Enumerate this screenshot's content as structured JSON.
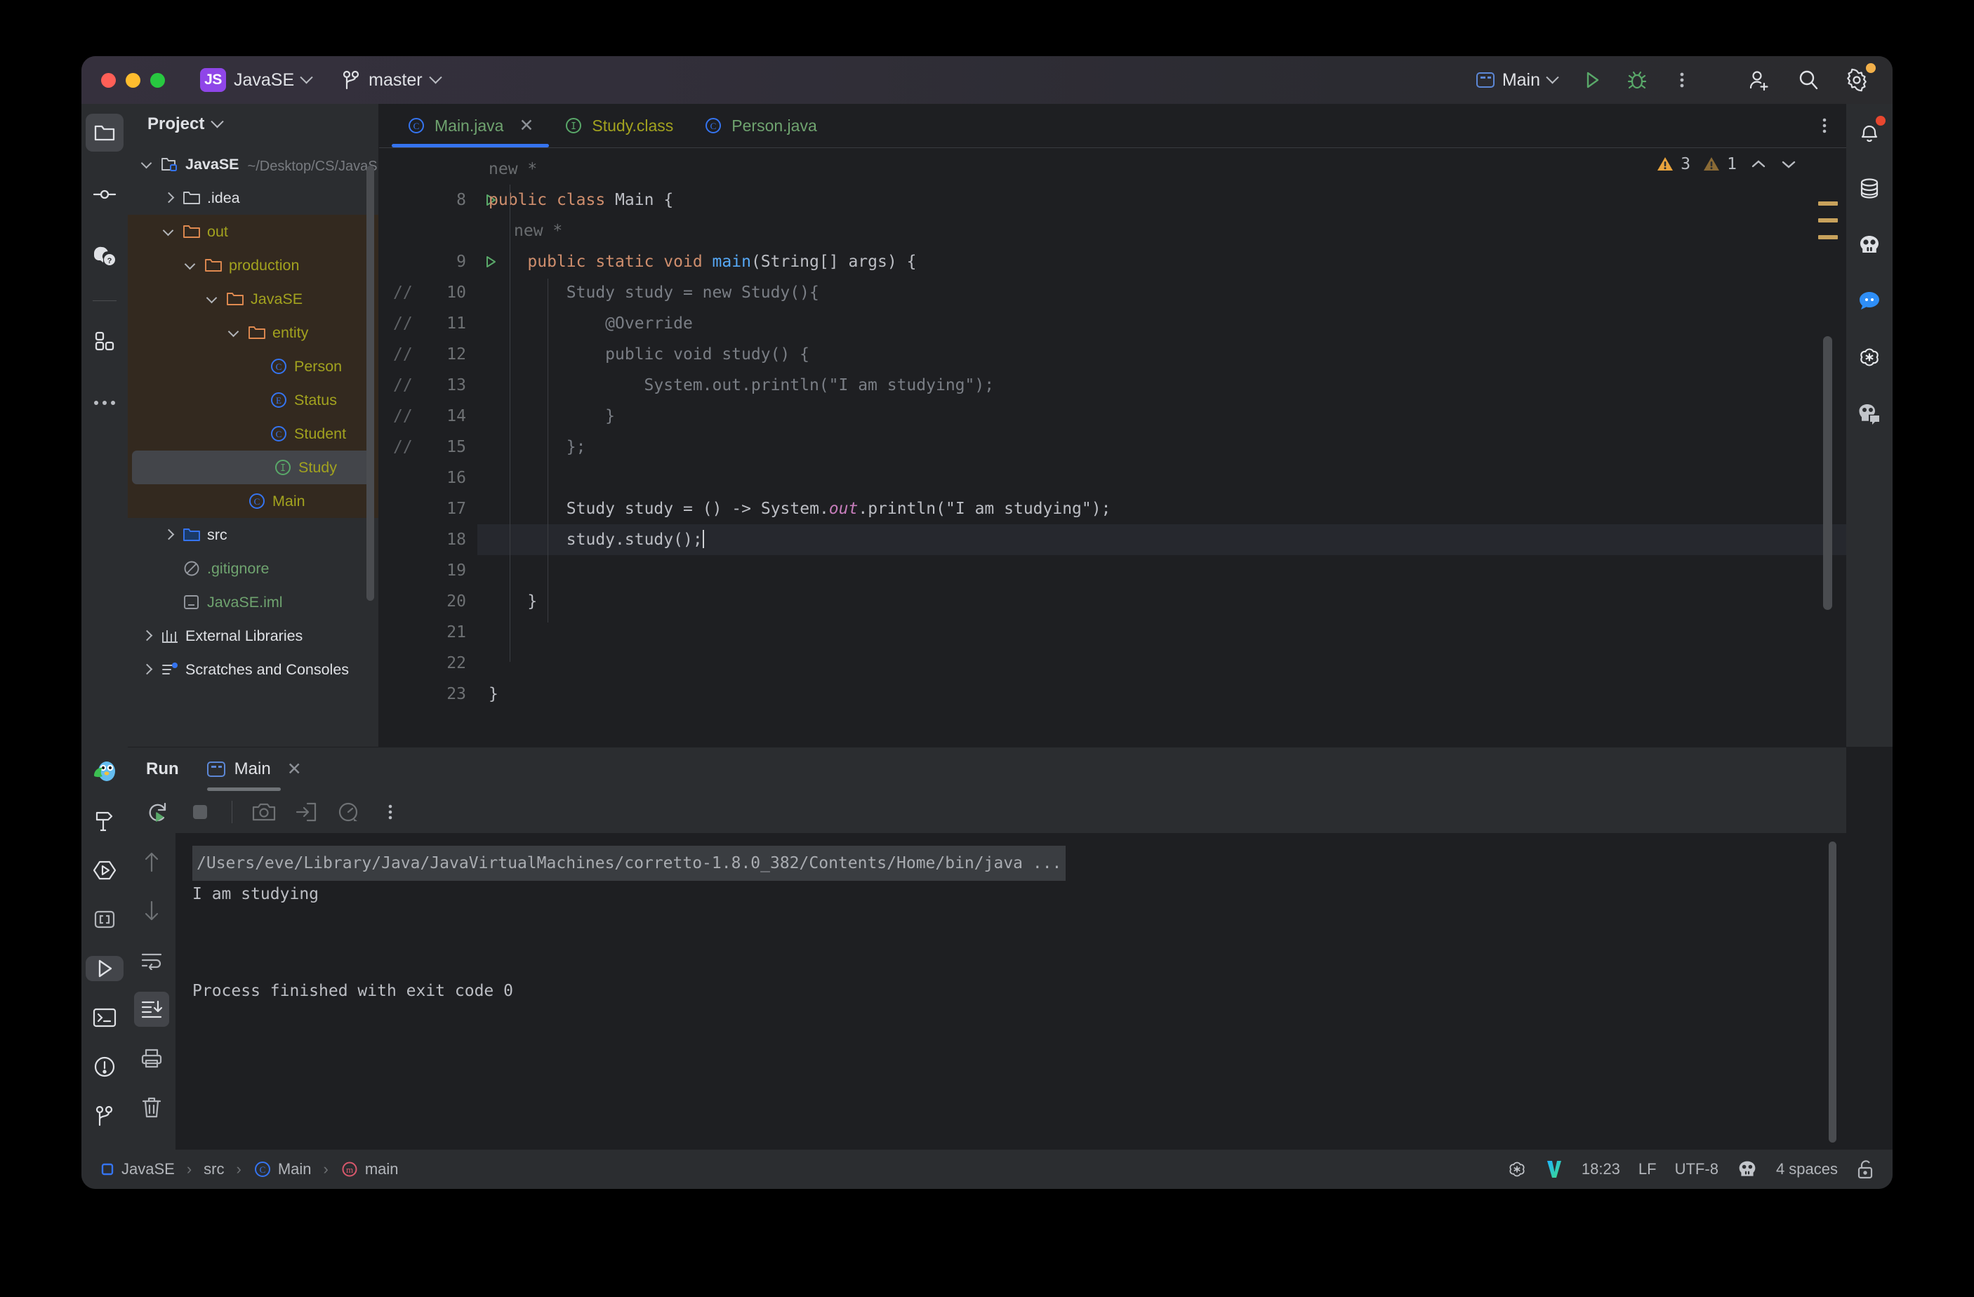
{
  "titlebar": {
    "project_badge": "JS",
    "project_name": "JavaSE",
    "branch": "master",
    "run_config": "Main",
    "icons": {
      "run": "run-icon",
      "debug": "debug-icon",
      "more": "more-vertical-icon",
      "add_user": "add-user-icon",
      "search": "search-icon",
      "settings": "settings-gear-icon"
    }
  },
  "left_rail": {
    "items": [
      {
        "name": "project-tool-window",
        "icon": "folder-icon",
        "active": true
      },
      {
        "name": "commit-tool-window",
        "icon": "commit-icon",
        "active": false
      },
      {
        "name": "ai-assistant-tool-window",
        "icon": "ai-assistant-icon",
        "active": false
      },
      {
        "name": "plugins-tool-window",
        "icon": "grid-squares-icon",
        "active": false
      },
      {
        "name": "more-tool-windows",
        "icon": "more-horizontal-icon",
        "active": false
      }
    ],
    "bottom_items": [
      {
        "name": "mascot-tool-window",
        "icon": "mascot-icon",
        "active": false
      },
      {
        "name": "build-tool-window",
        "icon": "hammer-icon",
        "active": false
      },
      {
        "name": "services-tool-window",
        "icon": "hexagon-play-icon",
        "active": false
      },
      {
        "name": "structure-tool-window",
        "icon": "brackets-icon",
        "active": false
      },
      {
        "name": "run-tool-window",
        "icon": "run-icon",
        "active": true
      },
      {
        "name": "terminal-tool-window",
        "icon": "terminal-icon",
        "active": false
      },
      {
        "name": "problems-tool-window",
        "icon": "warning-circle-icon",
        "active": false
      },
      {
        "name": "version-control-tool-window",
        "icon": "branch-icon",
        "active": false
      }
    ]
  },
  "project_panel": {
    "title": "Project",
    "tree": [
      {
        "label": "JavaSE",
        "sub": "~/Desktop/CS/JavaSE基础",
        "icon": "module-folder-icon",
        "depth": 0,
        "arrow": "open",
        "color": "white",
        "bold": true
      },
      {
        "label": ".idea",
        "sub": "",
        "icon": "folder-icon",
        "depth": 1,
        "arrow": "closed",
        "color": "white",
        "bold": false
      },
      {
        "label": "out",
        "sub": "",
        "icon": "folder-orange-icon",
        "depth": 1,
        "arrow": "open",
        "color": "olive",
        "bold": false
      },
      {
        "label": "production",
        "sub": "",
        "icon": "folder-orange-icon",
        "depth": 2,
        "arrow": "open",
        "color": "olive",
        "bold": false
      },
      {
        "label": "JavaSE",
        "sub": "",
        "icon": "folder-orange-icon",
        "depth": 3,
        "arrow": "open",
        "color": "olive",
        "bold": false
      },
      {
        "label": "entity",
        "sub": "",
        "icon": "folder-orange-icon",
        "depth": 4,
        "arrow": "open",
        "color": "olive",
        "bold": false
      },
      {
        "label": "Person",
        "sub": "",
        "icon": "class-icon",
        "depth": 5,
        "arrow": "none",
        "color": "olive",
        "bold": false
      },
      {
        "label": "Status",
        "sub": "",
        "icon": "enum-icon",
        "depth": 5,
        "arrow": "none",
        "color": "olive",
        "bold": false
      },
      {
        "label": "Student",
        "sub": "",
        "icon": "class-icon",
        "depth": 5,
        "arrow": "none",
        "color": "olive",
        "bold": false
      },
      {
        "label": "Study",
        "sub": "",
        "icon": "interface-icon",
        "depth": 5,
        "arrow": "none",
        "color": "olive",
        "bold": false,
        "selected": true
      },
      {
        "label": "Main",
        "sub": "",
        "icon": "class-icon",
        "depth": 4,
        "arrow": "none",
        "color": "olive",
        "bold": false
      },
      {
        "label": "src",
        "sub": "",
        "icon": "folder-blue-icon",
        "depth": 1,
        "arrow": "closed",
        "color": "white",
        "bold": false
      },
      {
        "label": ".gitignore",
        "sub": "",
        "icon": "gitignore-icon",
        "depth": 1,
        "arrow": "none",
        "color": "green",
        "bold": false
      },
      {
        "label": "JavaSE.iml",
        "sub": "",
        "icon": "iml-icon",
        "depth": 1,
        "arrow": "none",
        "color": "green",
        "bold": false
      },
      {
        "label": "External Libraries",
        "sub": "",
        "icon": "libraries-icon",
        "depth": 0,
        "arrow": "closed",
        "color": "white",
        "bold": false
      },
      {
        "label": "Scratches and Consoles",
        "sub": "",
        "icon": "scratches-icon",
        "depth": 0,
        "arrow": "closed",
        "color": "white",
        "bold": false
      }
    ]
  },
  "editor": {
    "tabs": [
      {
        "label": "Main.java",
        "icon": "class-icon",
        "active": true,
        "closable": true,
        "color": "#6fa36f"
      },
      {
        "label": "Study.class",
        "icon": "interface-icon",
        "active": false,
        "closable": false,
        "color": "#a2a21f"
      },
      {
        "label": "Person.java",
        "icon": "class-icon",
        "active": false,
        "closable": false,
        "color": "#6fa36f"
      }
    ],
    "warnings": {
      "count_major": "3",
      "count_minor": "1"
    },
    "inlay_hints": [
      "new *",
      "new *"
    ],
    "lines": [
      {
        "num": "8",
        "run_marker": true,
        "comment_prefix": "",
        "text": "public class Main {"
      },
      {
        "num": "9",
        "run_marker": true,
        "comment_prefix": "",
        "text": "    public static void main(String[] args) {"
      },
      {
        "num": "10",
        "run_marker": false,
        "comment_prefix": "//",
        "text": "        Study study = new Study(){"
      },
      {
        "num": "11",
        "run_marker": false,
        "comment_prefix": "//",
        "text": "            @Override"
      },
      {
        "num": "12",
        "run_marker": false,
        "comment_prefix": "//",
        "text": "            public void study() {"
      },
      {
        "num": "13",
        "run_marker": false,
        "comment_prefix": "//",
        "text": "                System.out.println(\"I am studying\");"
      },
      {
        "num": "14",
        "run_marker": false,
        "comment_prefix": "//",
        "text": "            }"
      },
      {
        "num": "15",
        "run_marker": false,
        "comment_prefix": "//",
        "text": "        };"
      },
      {
        "num": "16",
        "run_marker": false,
        "comment_prefix": "",
        "text": ""
      },
      {
        "num": "17",
        "run_marker": false,
        "comment_prefix": "",
        "text": "        Study study = () -> System.out.println(\"I am studying\");"
      },
      {
        "num": "18",
        "run_marker": false,
        "comment_prefix": "",
        "text": "        study.study();",
        "current": true
      },
      {
        "num": "19",
        "run_marker": false,
        "comment_prefix": "",
        "text": ""
      },
      {
        "num": "20",
        "run_marker": false,
        "comment_prefix": "",
        "text": "    }"
      },
      {
        "num": "21",
        "run_marker": false,
        "comment_prefix": "",
        "text": ""
      },
      {
        "num": "22",
        "run_marker": false,
        "comment_prefix": "",
        "text": ""
      },
      {
        "num": "23",
        "run_marker": false,
        "comment_prefix": "",
        "text": "}"
      }
    ]
  },
  "right_rail": {
    "items": [
      {
        "name": "notifications",
        "icon": "bell-icon",
        "badge": "#e8472f"
      },
      {
        "name": "database",
        "icon": "database-icon",
        "badge": ""
      },
      {
        "name": "ai-assistant",
        "icon": "ai-face-icon",
        "badge": ""
      },
      {
        "name": "chat",
        "icon": "chat-bubble-icon",
        "badge": ""
      },
      {
        "name": "chatgpt",
        "icon": "openai-icon",
        "badge": ""
      },
      {
        "name": "copilot-chat",
        "icon": "assistant-chat-icon",
        "badge": ""
      }
    ]
  },
  "run_window": {
    "title": "Run",
    "tab_label": "Main",
    "tab_icon": "run-config-icon",
    "toolbar": [
      {
        "name": "rerun-button",
        "icon": "rerun-icon"
      },
      {
        "name": "stop-button",
        "icon": "stop-icon"
      },
      {
        "name": "screenshot-button",
        "icon": "camera-icon"
      },
      {
        "name": "thread-dump-button",
        "icon": "import-arrow-icon"
      },
      {
        "name": "profiler-button",
        "icon": "gauge-icon"
      },
      {
        "name": "run-more-button",
        "icon": "more-vertical-icon"
      }
    ],
    "console_rail": [
      {
        "name": "scroll-up-button",
        "icon": "arrow-up-icon",
        "active": false
      },
      {
        "name": "scroll-down-button",
        "icon": "arrow-down-icon",
        "active": false
      },
      {
        "name": "soft-wrap-button",
        "icon": "soft-wrap-icon",
        "active": false
      },
      {
        "name": "scroll-to-end-button",
        "icon": "scroll-to-end-icon",
        "active": true
      },
      {
        "name": "print-button",
        "icon": "printer-icon",
        "active": false
      },
      {
        "name": "clear-all-button",
        "icon": "trash-icon",
        "active": false
      }
    ],
    "console": {
      "command": "/Users/eve/Library/Java/JavaVirtualMachines/corretto-1.8.0_382/Contents/Home/bin/java ...",
      "output": [
        "I am studying",
        "",
        "",
        "Process finished with exit code 0"
      ]
    }
  },
  "statusbar": {
    "breadcrumb": [
      {
        "label": "JavaSE",
        "icon": "module-icon"
      },
      {
        "label": "src",
        "icon": ""
      },
      {
        "label": "Main",
        "icon": "class-icon"
      },
      {
        "label": "main",
        "icon": "method-icon"
      }
    ],
    "time": "18:23",
    "line_separator": "LF",
    "encoding": "UTF-8",
    "indent": "4 spaces",
    "icons": [
      "openai-icon",
      "v-logo-icon",
      "ai-face-icon",
      "unlock-icon"
    ]
  }
}
